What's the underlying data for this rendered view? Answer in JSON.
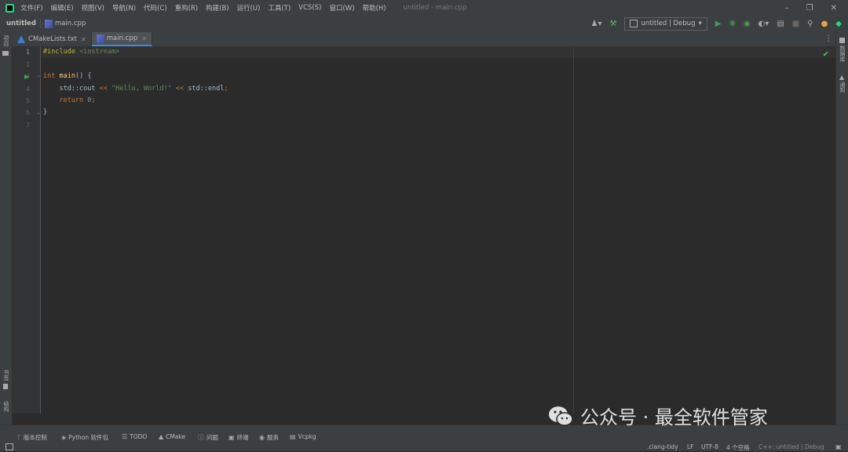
{
  "menu": {
    "items": [
      "文件(F)",
      "编辑(E)",
      "视图(V)",
      "导航(N)",
      "代码(C)",
      "重构(R)",
      "构建(B)",
      "运行(U)",
      "工具(T)",
      "VCS(S)",
      "窗口(W)",
      "帮助(H)"
    ],
    "window_title": "untitled - main.cpp"
  },
  "nav": {
    "project": "untitled",
    "file": "main.cpp",
    "run_config": "untitled | Debug"
  },
  "tabs": [
    {
      "label": "CMakeLists.txt",
      "icon": "cmake-icon"
    },
    {
      "label": "main.cpp",
      "icon": "cpp-file-icon",
      "active": true
    }
  ],
  "left_strip": {
    "top": "项目",
    "bottom_a": "书签",
    "bottom_b": "结构"
  },
  "right_strip": {
    "top": "数据库",
    "second": "通知"
  },
  "editor": {
    "line_numbers": [
      "1",
      "2",
      "3",
      "4",
      "5",
      "6",
      "7"
    ],
    "lines": [
      {
        "tokens": [
          {
            "t": "#include ",
            "c": "pp"
          },
          {
            "t": "<iostream>",
            "c": "inc"
          }
        ]
      },
      {
        "tokens": []
      },
      {
        "tokens": [
          {
            "t": "int ",
            "c": "kw"
          },
          {
            "t": "main",
            "c": "fn"
          },
          {
            "t": "() {",
            "c": "plain"
          }
        ]
      },
      {
        "tokens": [
          {
            "t": "    std::cout ",
            "c": "plain"
          },
          {
            "t": "<< ",
            "c": "kw"
          },
          {
            "t": "\"Hello, World!\"",
            "c": "str"
          },
          {
            "t": " << ",
            "c": "kw"
          },
          {
            "t": "std::endl",
            "c": "plain"
          },
          {
            "t": ";",
            "c": "kw"
          }
        ]
      },
      {
        "tokens": [
          {
            "t": "    return ",
            "c": "kw"
          },
          {
            "t": "0",
            "c": "num"
          },
          {
            "t": ";",
            "c": "kw"
          }
        ]
      },
      {
        "tokens": [
          {
            "t": "}",
            "c": "plain"
          }
        ]
      },
      {
        "tokens": []
      }
    ]
  },
  "tool_windows": [
    {
      "label": "版本控制",
      "icon": "branch-icon"
    },
    {
      "label": "Python 软件包",
      "icon": "package-icon"
    },
    {
      "label": "TODO",
      "icon": "list-icon"
    },
    {
      "label": "CMake",
      "icon": "cmake-icon"
    },
    {
      "label": "问题",
      "icon": "info-icon"
    },
    {
      "label": "终端",
      "icon": "terminal-icon"
    },
    {
      "label": "服务",
      "icon": "services-icon"
    },
    {
      "label": "Vcpkg",
      "icon": "vcpkg-icon"
    }
  ],
  "status": {
    "clang_tidy": ".clang-tidy",
    "line_sep": "LF",
    "encoding": "UTF-8",
    "indent": "4 个空格",
    "context": "C++: untitled | Debug"
  },
  "watermark": "公众号 · 最全软件管家",
  "colors": {
    "bg": "#2b2b2b",
    "panel": "#3c3f41",
    "keyword": "#cc7832",
    "string": "#6a8759",
    "number": "#6897bb",
    "function": "#ffc66d",
    "accent": "#4a88c7"
  }
}
